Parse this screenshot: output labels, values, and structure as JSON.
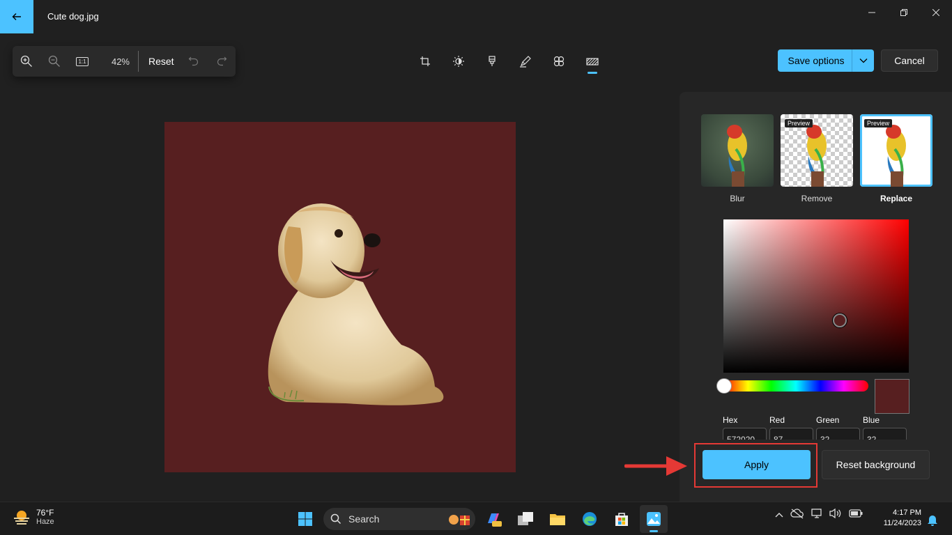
{
  "window": {
    "title": "Cute dog.jpg",
    "controls": [
      "minimize",
      "restore",
      "close"
    ]
  },
  "zoombar": {
    "zoom_percent": "42%",
    "reset_label": "Reset",
    "tools": [
      "zoom-in-icon",
      "zoom-out-icon",
      "actual-size-icon",
      "undo-icon",
      "redo-icon"
    ],
    "actual_size_glyph": "1:1"
  },
  "toolbar": {
    "tools": [
      "crop-icon",
      "adjust-icon",
      "filter-icon",
      "markup-icon",
      "erase-icon",
      "background-icon"
    ],
    "active_tool": "background-icon",
    "save_label": "Save options",
    "cancel_label": "Cancel"
  },
  "background_panel": {
    "options": [
      {
        "label": "Blur",
        "preview": false,
        "selected": false
      },
      {
        "label": "Remove",
        "preview": true,
        "selected": false
      },
      {
        "label": "Replace",
        "preview": true,
        "selected": true
      }
    ],
    "preview_tag": "Preview",
    "color": {
      "hex_label": "Hex",
      "red_label": "Red",
      "green_label": "Green",
      "blue_label": "Blue",
      "hex_value": "572020",
      "red_value": "87",
      "green_value": "32",
      "blue_value": "32",
      "selected_color": "#571f20",
      "hue_position": 0
    },
    "apply_label": "Apply",
    "reset_background_label": "Reset background"
  },
  "annotation": {
    "highlight_color": "#e53935"
  },
  "taskbar": {
    "weather_temp": "76°F",
    "weather_desc": "Haze",
    "search_label": "Search",
    "apps": [
      "start-icon",
      "copilot-icon",
      "task-view-icon",
      "file-explorer-icon",
      "edge-icon",
      "store-icon",
      "photos-icon"
    ],
    "active_app": "photos-icon",
    "time": "4:17 PM",
    "date": "11/24/2023"
  },
  "colors": {
    "accent": "#4cc2ff",
    "canvas_background": "#571f20"
  }
}
